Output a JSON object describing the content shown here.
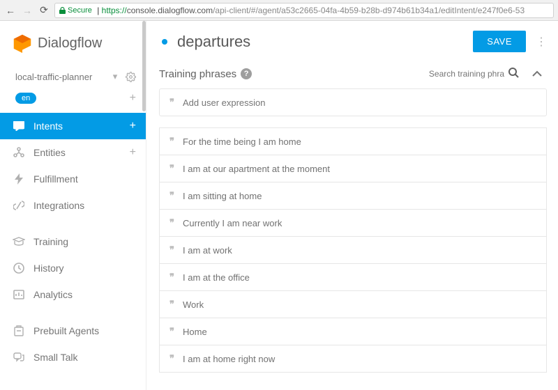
{
  "browser": {
    "secure_label": "Secure",
    "url_proto": "https://",
    "url_host": "console.dialogflow.com",
    "url_path": "/api-client/#/agent/a53c2665-04fa-4b59-b28b-d974b61b34a1/editIntent/e247f0e6-53"
  },
  "brand": "Dialogflow",
  "agent": {
    "name": "local-traffic-planner",
    "lang": "en"
  },
  "nav": {
    "intents": "Intents",
    "entities": "Entities",
    "fulfillment": "Fulfillment",
    "integrations": "Integrations",
    "training": "Training",
    "history": "History",
    "analytics": "Analytics",
    "prebuilt": "Prebuilt Agents",
    "smalltalk": "Small Talk"
  },
  "intent": {
    "name": "departures",
    "save": "SAVE",
    "section": "Training phrases",
    "search_placeholder": "Search training phra",
    "add_placeholder": "Add user expression",
    "phrases": [
      "For the time being I am home",
      "I am at our apartment at the moment",
      "I am sitting at home",
      "Currently I am near work",
      "I am at work",
      "I am at the office",
      "Work",
      "Home",
      "I am at home right now"
    ]
  }
}
